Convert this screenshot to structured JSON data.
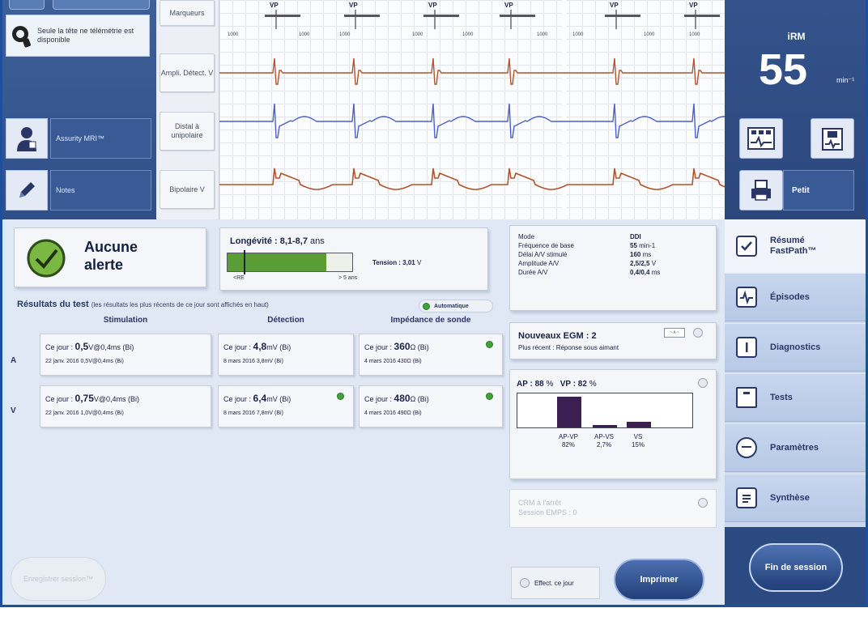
{
  "left_strip": {
    "info_text": "Seule la tête ne télémétrie est disponible",
    "assurity_label": "Assurity MRI™",
    "notes_label": "Notes"
  },
  "wave_labels": {
    "marqueurs": "Marqueurs",
    "ampl_detect": "Ampli. Détect. V",
    "distal_unipolaire": "Distal à unipolaire",
    "bipolaire": "Bipolaire V"
  },
  "wave_markers": {
    "vp": "VP",
    "values_row": [
      "1000",
      "1000",
      "1000",
      "1000",
      "1000",
      "1000",
      "1000",
      "1000",
      "1000"
    ]
  },
  "header": {
    "irm_label": "iRM",
    "rate_value": "55",
    "rate_unit": "min⁻¹",
    "petit_label": "Petit"
  },
  "alert": {
    "line1": "Aucune",
    "line2": "alerte"
  },
  "longevity": {
    "title": "Longévité : 8,1-8,7",
    "unit": "ans",
    "scale_left": "<RE",
    "scale_right": "> 5 ans",
    "fill_fraction": 0.79,
    "mark_fraction": 0.13,
    "tension_label": "Tension : 3,01",
    "tension_unit": "V"
  },
  "results": {
    "title": "Résultats du test",
    "note": "(les résultats les plus récents de ce jour sont affichés en haut)",
    "auto_label": "Automatique",
    "col_stim": "Stimulation",
    "col_detect": "Détection",
    "col_imped": "Impédance de sonde",
    "row_a": "A",
    "row_v": "V",
    "stim_a_l1_prefix": "Ce jour :",
    "stim_a_l1_value": "0,5",
    "stim_a_l1_rest": "V@0,4ms (Bi)",
    "stim_a_l2": "22 janv. 2016  0,5V@0,4ms (Bi)",
    "det_a_l1_prefix": "Ce jour :",
    "det_a_l1_value": "4,8",
    "det_a_l1_rest": "mV (Bi)",
    "det_a_l2": "8 mars 2016  3,8mV (Bi)",
    "imp_a_l1_prefix": "Ce jour :",
    "imp_a_l1_value": "360",
    "imp_a_l1_rest": "Ω (Bi)",
    "imp_a_l2": "4 mars 2016  430Ω (Bi)",
    "stim_v_l1_prefix": "Ce jour :",
    "stim_v_l1_value": "0,75",
    "stim_v_l1_rest": "V@0,4ms (Bi)",
    "stim_v_l2": "22 janv. 2016  1,0V@0,4ms (Bi)",
    "det_v_l1_prefix": "Ce jour :",
    "det_v_l1_value": "6,4",
    "det_v_l1_rest": "mV (Bi)",
    "det_v_l2": "8 mars 2016  7,8mV (Bi)",
    "imp_v_l1_prefix": "Ce jour :",
    "imp_v_l1_value": "480",
    "imp_v_l1_rest": "Ω (Bi)",
    "imp_v_l2": "4 mars 2016  490Ω (Bi)"
  },
  "mode": {
    "k_mode": "Mode",
    "v_mode": "DDI",
    "k_freq": "Fréquence de base",
    "v_freq": "55",
    "u_freq": "min-1",
    "k_delai": "Délai A/V stimulé",
    "v_delai": "160",
    "u_delai": "ms",
    "k_ampl": "Amplitude A/V",
    "v_ampl": "2,5/2,5",
    "u_ampl": "V",
    "k_duree": "Durée A/V",
    "v_duree": "0,4/0,4",
    "u_duree": "ms"
  },
  "egm": {
    "title": "Nouveaux EGM : 2",
    "subtitle": "Plus récent : Réponse sous aimant"
  },
  "percent": {
    "ap_label": "AP : 88",
    "vp_label": "VP : 82",
    "unit": "%",
    "bars": [
      {
        "name": "AP-VP",
        "value": 82,
        "label": "82%"
      },
      {
        "name": "AP-VS",
        "value": 2.7,
        "label": "2,7%"
      },
      {
        "name": "VS",
        "value": 15,
        "label": "15%"
      }
    ]
  },
  "crm": {
    "line1": "CRM à l'arrêt",
    "line2": "Session EMPS : 0"
  },
  "footer": {
    "ghost_label": "Enregistrer session™",
    "effect_label": "Effect. ce jour",
    "print_label": "Imprimer"
  },
  "nav": {
    "resume_label": "Résumé FastPath™",
    "episodes_label": "Épisodes",
    "diagnostics_label": "Diagnostics",
    "tests_label": "Tests",
    "parametres_label": "Paramètres",
    "synthese_label": "Synthèse",
    "fin_label": "Fin de session"
  },
  "colors": {
    "accent": "#2b4a82",
    "green": "#3fa33a",
    "atrial_wave": "#b3532f",
    "ventricular_wave": "#4b5fd0"
  }
}
